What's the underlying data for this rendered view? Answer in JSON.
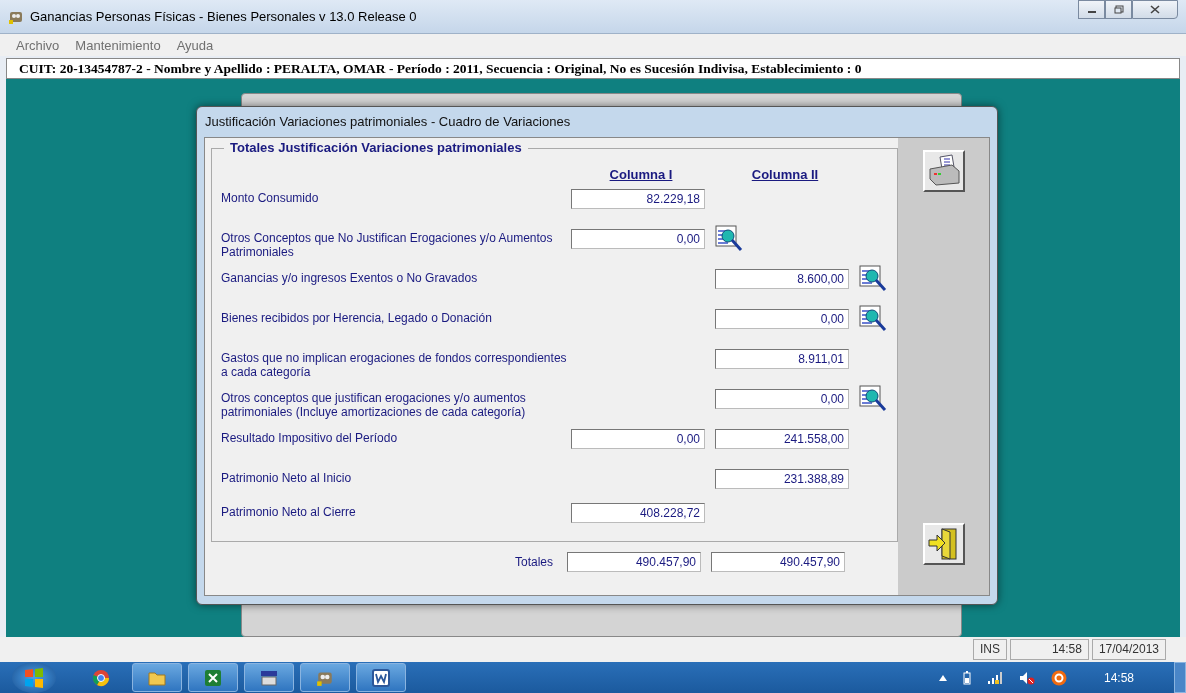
{
  "window": {
    "title": "Ganancias Personas Físicas - Bienes Personales v 13.0 Release 0"
  },
  "menu": [
    {
      "label": "Archivo"
    },
    {
      "label": "Mantenimiento"
    },
    {
      "label": "Ayuda"
    }
  ],
  "info_bar": "CUIT: 20-13454787-2 -  Nombre y Apellido : PERALTA, OMAR -  Período : 2011,  Secuencia : Original, No es Sucesión Indivisa, Establecimiento : 0",
  "dialog": {
    "title": "Justificación Variaciones patrimoniales - Cuadro de Variaciones",
    "group_title": "Totales Justificación Variaciones patrimoniales",
    "column_headers": [
      "Columna I",
      "Columna II"
    ],
    "rows": [
      {
        "label": "Monto Consumido",
        "column_1": "82.229,18",
        "lookup_button": false
      },
      {
        "label": "Otros Conceptos que No Justifican Erogaciones y/o Aumentos\nPatrimoniales",
        "column_1": "0,00",
        "lookup_button": true
      },
      {
        "label": "Ganancias y/o ingresos Exentos o No Gravados",
        "column_2": "8.600,00",
        "lookup_button": true
      },
      {
        "label": "Bienes recibidos por Herencia, Legado o Donación",
        "column_2": "0,00",
        "lookup_button": true
      },
      {
        "label": "Gastos que no implican erogaciones de fondos correspondientes\na cada categoría",
        "column_2": "8.911,01",
        "lookup_button": false
      },
      {
        "label": "Otros conceptos que justifican erogaciones y/o aumentos\npatrimoniales (Incluye amortizaciones de cada categoría)",
        "column_2": "0,00",
        "lookup_button": true
      },
      {
        "label": "Resultado Impositivo del Período",
        "column_1": "0,00",
        "column_2": "241.558,00",
        "lookup_button": false
      },
      {
        "label": "Patrimonio Neto al Inicio",
        "column_2": "231.388,89",
        "lookup_button": false
      },
      {
        "label": "Patrimonio Neto al Cierre",
        "column_1": "408.228,72",
        "lookup_button": false
      }
    ],
    "totals": {
      "label": "Totales",
      "column_1": "490.457,90",
      "column_2": "490.457,90"
    }
  },
  "status_bar": {
    "mode": "INS",
    "time": "14:58",
    "date": "17/04/2013"
  },
  "taskbar": {
    "clock": "14:58"
  }
}
